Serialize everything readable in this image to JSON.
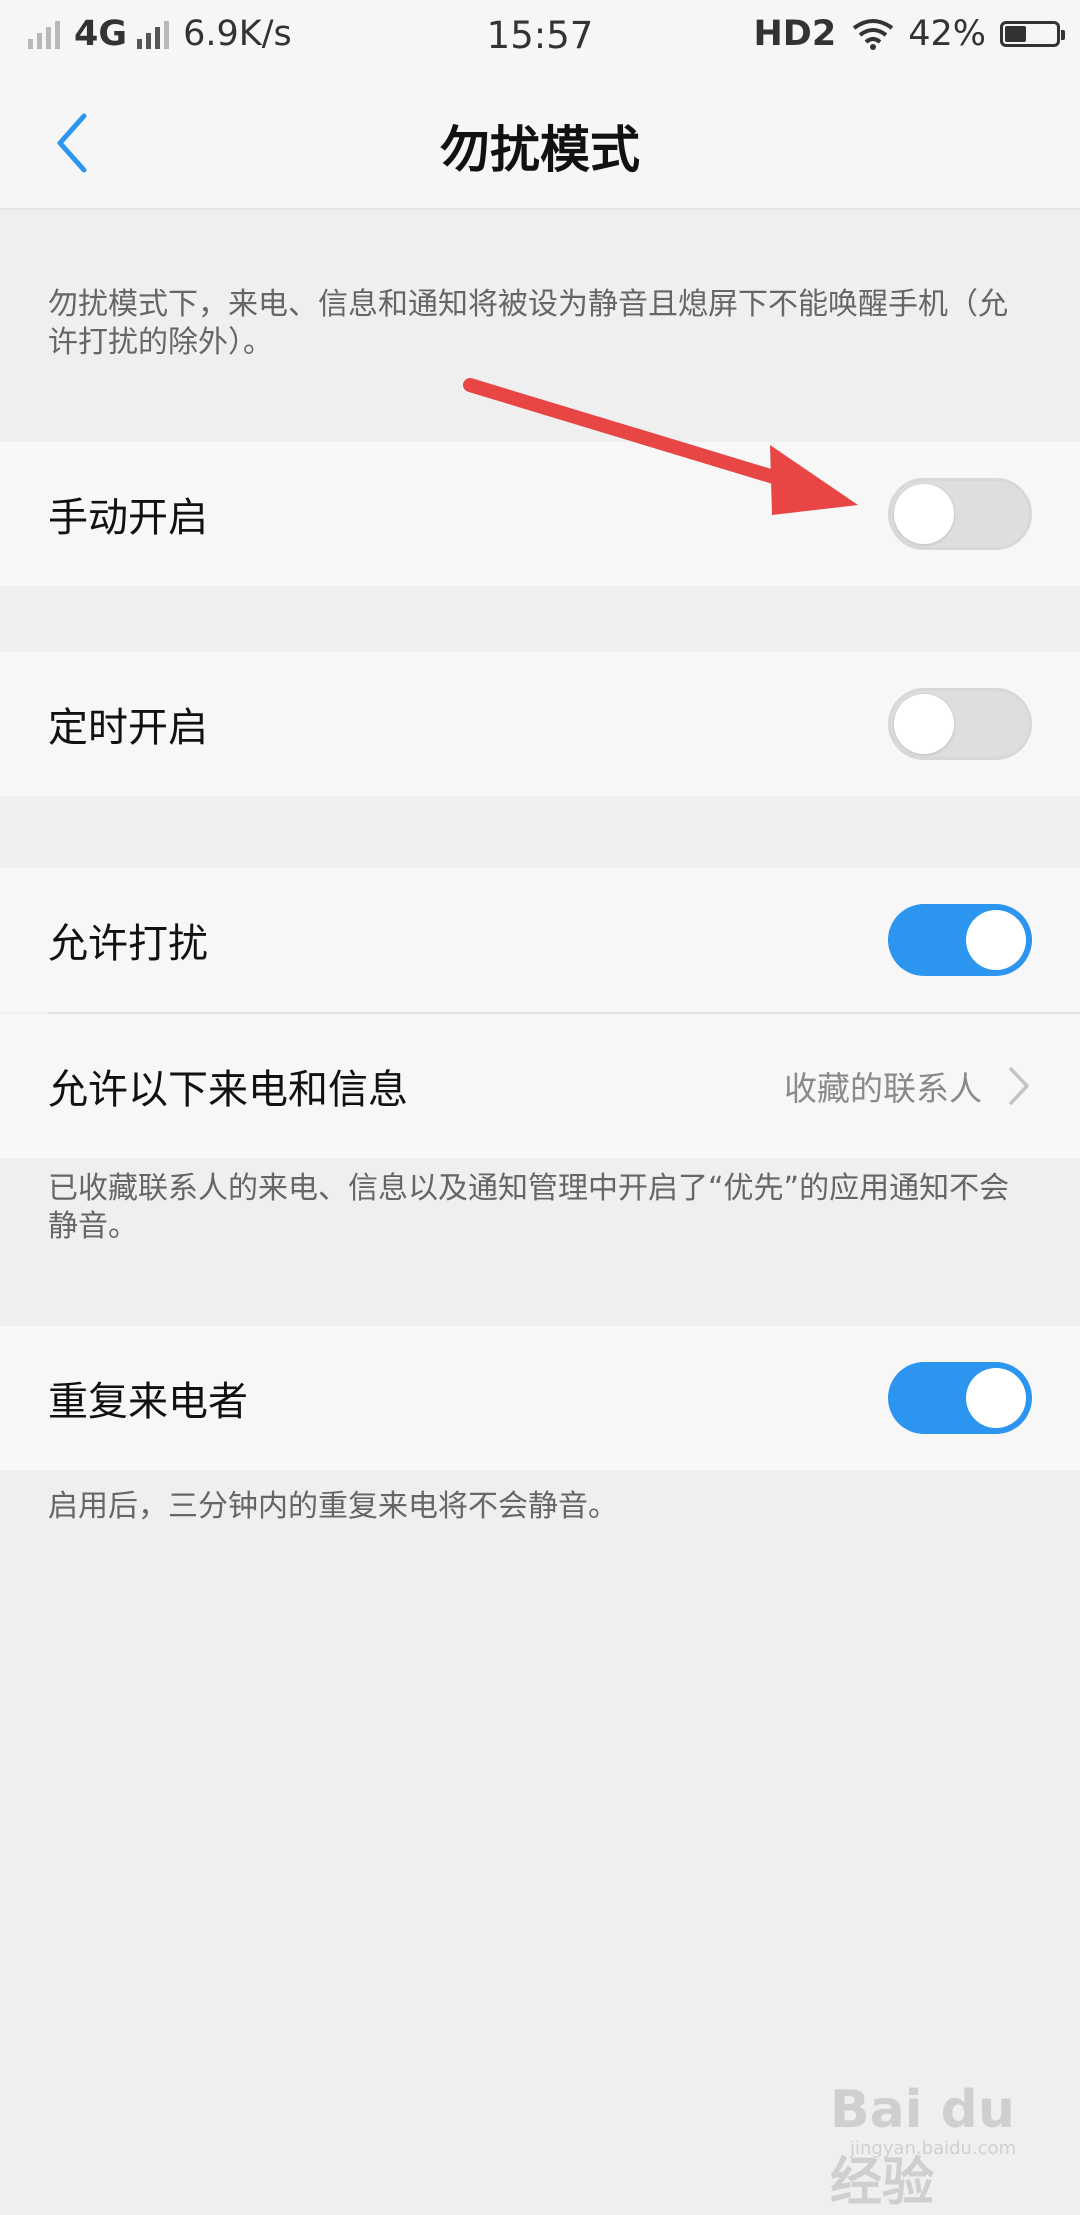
{
  "status_bar": {
    "network": "4G",
    "speed": "6.9K/s",
    "time": "15:57",
    "hd": "HD2",
    "battery_text": "42%",
    "battery_level": 0.42
  },
  "header": {
    "title": "勿扰模式",
    "back_icon": "chevron-left-icon"
  },
  "intro_note": "勿扰模式下，来电、信息和通知将被设为静音且熄屏下不能唤醒手机（允许打扰的除外）。",
  "settings": {
    "manual": {
      "label": "手动开启",
      "enabled": false
    },
    "scheduled": {
      "label": "定时开启",
      "enabled": false
    },
    "allow_interrupt": {
      "label": "允许打扰",
      "enabled": true
    },
    "allow_calls": {
      "label": "允许以下来电和信息",
      "value": "收藏的联系人"
    },
    "allow_note": "已收藏联系人的来电、信息以及通知管理中开启了“优先”的应用通知不会静音。",
    "repeat_callers": {
      "label": "重复来电者",
      "enabled": true
    },
    "repeat_note": "启用后，三分钟内的重复来电将不会静音。"
  },
  "watermark": {
    "text": "Bai du 经验",
    "sub": "jingyan.baidu.com"
  },
  "colors": {
    "accent": "#2b95f0",
    "annotation_arrow": "#e84545",
    "toggle_off": "#dedede"
  }
}
